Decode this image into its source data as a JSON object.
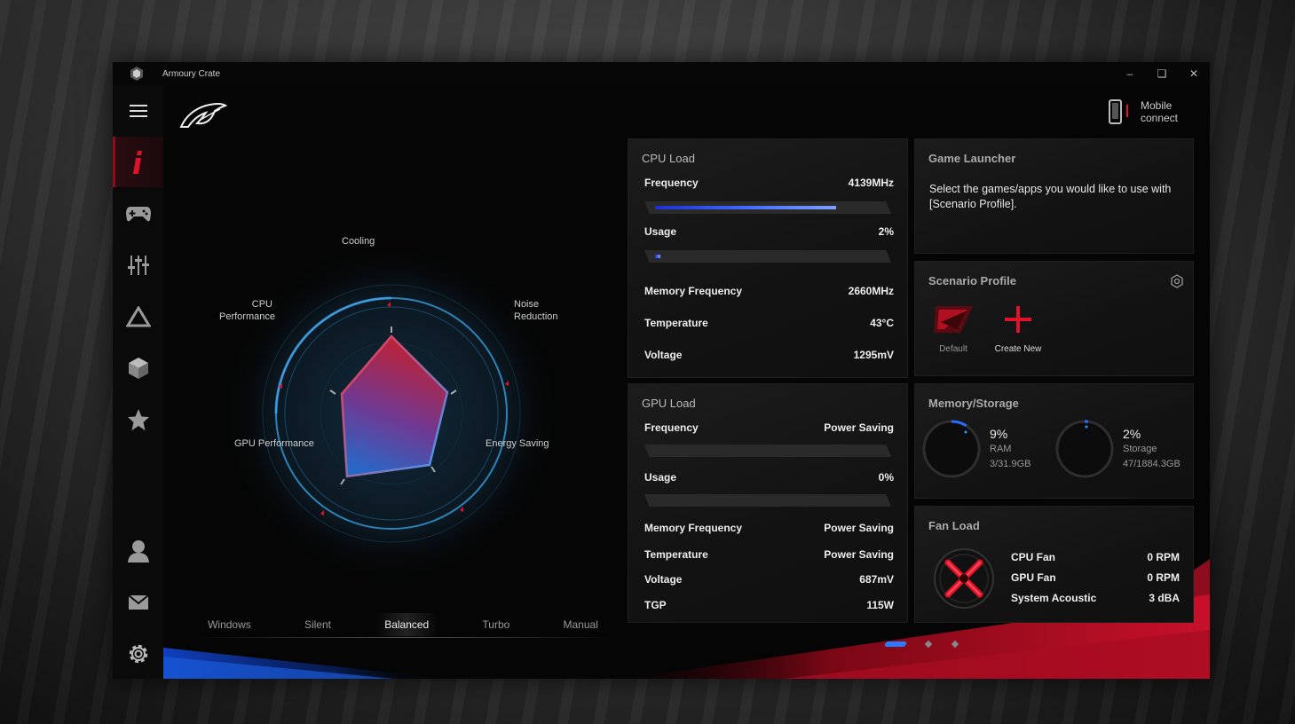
{
  "window": {
    "title": "Armoury Crate"
  },
  "header": {
    "mobile_connect": [
      "Mobile",
      "connect"
    ]
  },
  "sidebar": {
    "icons": [
      "menu-icon",
      "home-icon",
      "gamepad-icon",
      "sliders-icon",
      "aura-icon",
      "cube-icon",
      "star-icon",
      "user-icon",
      "mail-icon",
      "gear-icon"
    ],
    "active_index": 1
  },
  "radar": {
    "labels": {
      "cooling": "Cooling",
      "cpu": [
        "CPU",
        "Performance"
      ],
      "noise": [
        "Noise",
        "Reduction"
      ],
      "gpu": "GPU Performance",
      "energy": "Energy Saving"
    }
  },
  "modes": {
    "items": [
      "Windows",
      "Silent",
      "Balanced",
      "Turbo",
      "Manual"
    ],
    "active": "Balanced"
  },
  "cpu_load": {
    "title": "CPU Load",
    "frequency_label": "Frequency",
    "frequency": "4139MHz",
    "frequency_bar": 0.78,
    "usage_label": "Usage",
    "usage": "2%",
    "usage_bar": 0.02,
    "memfreq_label": "Memory Frequency",
    "memfreq": "2660MHz",
    "temp_label": "Temperature",
    "temp": "43°C",
    "volt_label": "Voltage",
    "volt": "1295mV"
  },
  "gpu_load": {
    "title": "GPU Load",
    "frequency_label": "Frequency",
    "frequency": "Power Saving",
    "usage_label": "Usage",
    "usage": "0%",
    "memfreq_label": "Memory Frequency",
    "memfreq": "Power Saving",
    "temp_label": "Temperature",
    "temp": "Power Saving",
    "volt_label": "Voltage",
    "volt": "687mV",
    "tgp_label": "TGP",
    "tgp": "115W"
  },
  "game_launcher": {
    "title": "Game Launcher",
    "text": "Select the games/apps you would like to use with [Scenario Profile]."
  },
  "scenario_profile": {
    "title": "Scenario Profile",
    "default_label": "Default",
    "create_label": "Create New"
  },
  "memory_storage": {
    "title": "Memory/Storage",
    "ram": {
      "pct": "9%",
      "label": "RAM",
      "detail": "3/31.9GB",
      "fraction": 0.09
    },
    "storage": {
      "pct": "2%",
      "label": "Storage",
      "detail": "47/1884.3GB",
      "fraction": 0.02
    }
  },
  "fan_load": {
    "title": "Fan Load",
    "cpu_fan_label": "CPU Fan",
    "cpu_fan": "0 RPM",
    "gpu_fan_label": "GPU Fan",
    "gpu_fan": "0 RPM",
    "acoustic_label": "System Acoustic",
    "acoustic": "3 dBA"
  },
  "pager": {
    "pages": 3,
    "active": 0
  },
  "colors": {
    "accent_red": "#e0122a",
    "accent_blue": "#2a7bff"
  }
}
